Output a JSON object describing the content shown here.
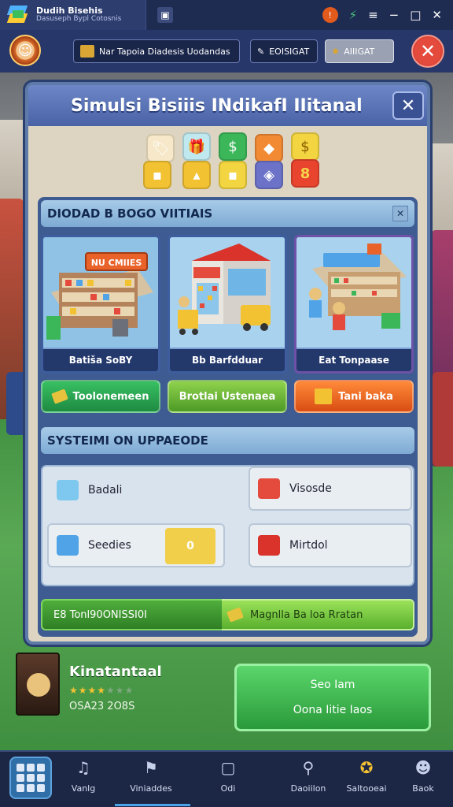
{
  "window": {
    "app_title": "Dudih Bisehis",
    "app_subtitle": "Dasuseph Bypl Cotosnis"
  },
  "toolbar": {
    "main_label": "Nar Tapoia Diadesis Uodandas",
    "second_label": "EOISIGAT",
    "third_label": "AIIIGAT"
  },
  "panel": {
    "title": "Simulsi Bisiiis INdikafI IIitanal"
  },
  "section1": {
    "header": "DIODAD B BOGO VIITIAIS",
    "cards": [
      {
        "label": "Batiša SoBY",
        "sign": "NU CMIIES"
      },
      {
        "label": "Bb Barfdduar",
        "sign": ""
      },
      {
        "label": "Eat Tonpaase",
        "sign": ""
      }
    ],
    "actions": [
      {
        "label": "Toolonemeen"
      },
      {
        "label": "Brotlai Ustenaea"
      },
      {
        "label": "Tani baka"
      }
    ]
  },
  "section2": {
    "header": "SYSTEIMI ON UPPAEODE",
    "upgrades": [
      {
        "label": "Badali",
        "color": "#7ec8ef"
      },
      {
        "label": "Visosde",
        "color": "#e44b3d"
      },
      {
        "label": "Seedies",
        "color": "#4fa3e6",
        "slot": "0"
      },
      {
        "label": "Mirtdol",
        "color": "#d9332b"
      }
    ],
    "bottom_left": "E8  Tonl90ONISSI0I",
    "bottom_right": "Magnlla Ba loa Rratan"
  },
  "game": {
    "name": "Kinatantaal",
    "stars": "★★★★",
    "rating": 4,
    "meta": "OSA23 2O8S",
    "play_line1": "Seo Iam",
    "play_line2": "Oona Iitie Iaos"
  },
  "nav": {
    "items": [
      {
        "label": "Vanlg",
        "icon": "music-note-icon"
      },
      {
        "label": "Viniaddes",
        "icon": "flag-icon"
      },
      {
        "label": "Odi",
        "icon": "box-icon"
      },
      {
        "label": "Daoiilon",
        "icon": "search-icon"
      },
      {
        "label": "Saltooeai",
        "icon": "medal-icon"
      },
      {
        "label": "Baok",
        "icon": "robot-icon"
      }
    ]
  },
  "colors": {
    "accent": "#4a63a6",
    "panel": "#ddd4c1",
    "play": "#2a9a3a",
    "close": "#e44b3d"
  }
}
